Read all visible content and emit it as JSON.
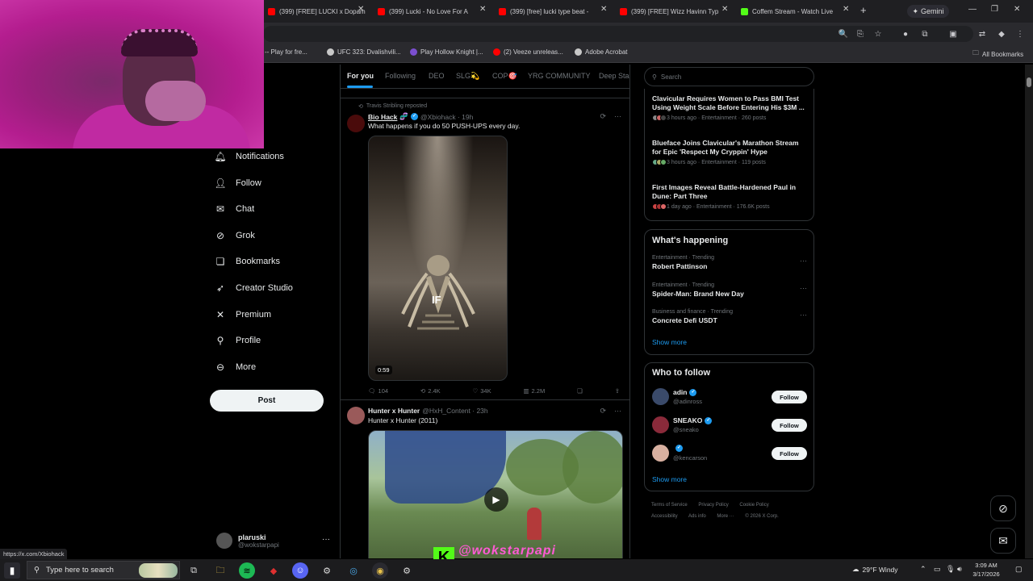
{
  "browser": {
    "tabs": [
      {
        "label": "(399) [FREE] LUCKI x Dopam",
        "fav": "#ff0000"
      },
      {
        "label": "(399) Lucki - No Love For A",
        "fav": "#ff0000"
      },
      {
        "label": "(399) [free] lucki type beat -",
        "fav": "#ff0000"
      },
      {
        "label": "(399) [FREE] Wizz Havinn Typ",
        "fav": "#ff0000"
      },
      {
        "label": "Coffem Stream - Watch Live",
        "fav": "#53fc18"
      }
    ],
    "new_tab": "+",
    "gemini_label": "Gemini",
    "bookmarks": [
      {
        "label": "-- Play for fre...",
        "fav": "#5865f2"
      },
      {
        "label": "UFC 323: Dvalishvili...",
        "fav": "#c8c8c8"
      },
      {
        "label": "Play Hollow Knight |...",
        "fav": "#7b4fd0"
      },
      {
        "label": "(2) Veeze unreleas...",
        "fav": "#ff0000"
      },
      {
        "label": "Adobe Acrobat",
        "fav": "#c8c8c8"
      }
    ],
    "all_bookmarks": "All Bookmarks",
    "status_url": "https://x.com/Xbiohack"
  },
  "nav": {
    "items": [
      {
        "label": "Notifications",
        "icon": "bell-icon",
        "glyph": "🔔"
      },
      {
        "label": "Follow",
        "icon": "follow-icon",
        "glyph": "👤"
      },
      {
        "label": "Chat",
        "icon": "mail-icon",
        "glyph": "✉"
      },
      {
        "label": "Grok",
        "icon": "grok-icon",
        "glyph": "⊘"
      },
      {
        "label": "Bookmarks",
        "icon": "bookmark-icon",
        "glyph": "🔖"
      },
      {
        "label": "Creator Studio",
        "icon": "rocket-icon",
        "glyph": "🚀"
      },
      {
        "label": "Premium",
        "icon": "x-logo-icon",
        "glyph": "𝕏"
      },
      {
        "label": "Profile",
        "icon": "profile-icon",
        "glyph": "👤"
      },
      {
        "label": "More",
        "icon": "more-circle-icon",
        "glyph": "⊖"
      }
    ],
    "post_label": "Post",
    "account": {
      "name": "plaruski",
      "handle": "@wokstarpapi",
      "more": "···"
    }
  },
  "feed": {
    "tabs": [
      "For you",
      "Following",
      "DEO",
      "SLG💫",
      "COP🎯",
      "YRG COMMUNITY",
      "Deep Sta"
    ],
    "tweet1": {
      "repost": "Travis Stribling reposted",
      "name": "Bio Hack",
      "emoji": "🧬",
      "handle": "@Xbiohack · 19h",
      "text": "What happens if you do 50 PUSH-UPS every day.",
      "duration": "0:59",
      "watermark": "IF",
      "replies": "104",
      "reposts": "2.4K",
      "likes": "34K",
      "views": "2.2M"
    },
    "tweet2": {
      "name": "Hunter x Hunter",
      "handle": "@HxH_Content · 23h",
      "text": "Hunter x Hunter (2011)"
    },
    "overlay_text": "@wokstarpapi"
  },
  "sidebar": {
    "search_placeholder": "Search",
    "news": [
      {
        "title": "Clavicular Requires Women to Pass BMI Test Using Weight Scale Before Entering His $3M ...",
        "meta": "3 hours ago · Entertainment · 260 posts"
      },
      {
        "title": "Blueface Joins Clavicular's Marathon Stream for Epic 'Respect My Cryppin' Hype",
        "meta": "3 hours ago · Entertainment · 119 posts"
      },
      {
        "title": "First Images Reveal Battle-Hardened Paul in Dune: Part Three",
        "meta": "1 day ago · Entertainment · 176.6K posts"
      }
    ],
    "whats_happening": "What's happening",
    "trends": [
      {
        "category": "Entertainment · Trending",
        "name": "Robert Pattinson"
      },
      {
        "category": "Entertainment · Trending",
        "name": "Spider-Man: Brand New Day"
      },
      {
        "category": "Business and finance · Trending",
        "name": "Concrete Defi USDT"
      }
    ],
    "show_more": "Show more",
    "who_to_follow": "Who to follow",
    "follow_suggestions": [
      {
        "name": "adin",
        "handle": "@adinross"
      },
      {
        "name": "SNEAKO",
        "handle": "@sneako"
      },
      {
        "name": "",
        "handle": "@kencarson"
      }
    ],
    "follow_label": "Follow",
    "footer": [
      "Terms of Service",
      "Privacy Policy",
      "Cookie Policy",
      "Accessibility",
      "Ads info",
      "More ···",
      "© 2026 X Corp."
    ]
  },
  "taskbar": {
    "search_placeholder": "Type here to search",
    "weather": "29°F  Windy",
    "time": "3:09 AM",
    "date": "3/17/2026"
  },
  "colors": {
    "accent": "#1d9bf0",
    "kick": "#53fc18"
  }
}
